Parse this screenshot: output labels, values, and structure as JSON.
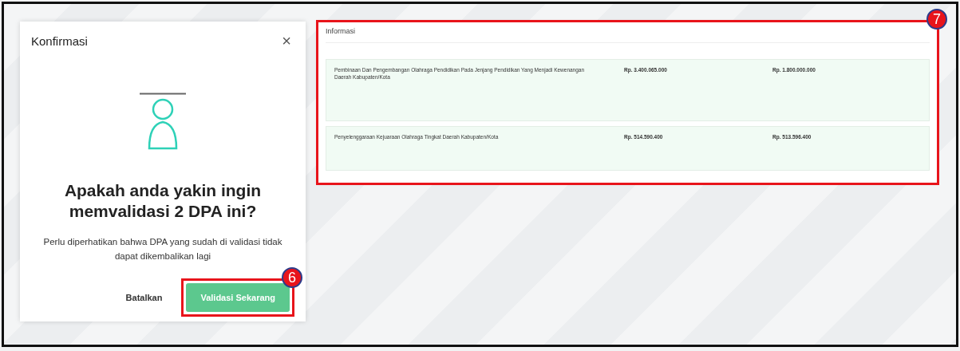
{
  "modal": {
    "title": "Konfirmasi",
    "close": "×",
    "question": "Apakah anda yakin ingin memvalidasi 2 DPA ini?",
    "note": "Perlu diperhatikan bahwa DPA yang sudah di validasi tidak dapat dikembalikan lagi",
    "buttons": [
      {
        "label": "Batalkan",
        "kind": "secondary"
      },
      {
        "label": "Validasi Sekarang",
        "kind": "primary"
      }
    ]
  },
  "info": {
    "title": "Informasi",
    "items": [
      {
        "name": "Pembinaan Dan Pengembangan Olahraga Pendidikan Pada Jenjang Pendidikan Yang Menjadi Kewenangan Daerah Kabupaten/Kota",
        "amount_1": "Rp. 3.400.065.000",
        "amount_2": "Rp. 1.800.000.000"
      },
      {
        "name": "Penyelenggaraan Kejuaraan Olahraga Tingkat Daerah Kabupaten/Kota",
        "amount_1": "Rp. 514.590.400",
        "amount_2": "Rp. 513.596.400"
      }
    ]
  },
  "callouts": [
    {
      "number": "6",
      "kind": "button"
    },
    {
      "number": "7",
      "kind": "panel"
    }
  ]
}
